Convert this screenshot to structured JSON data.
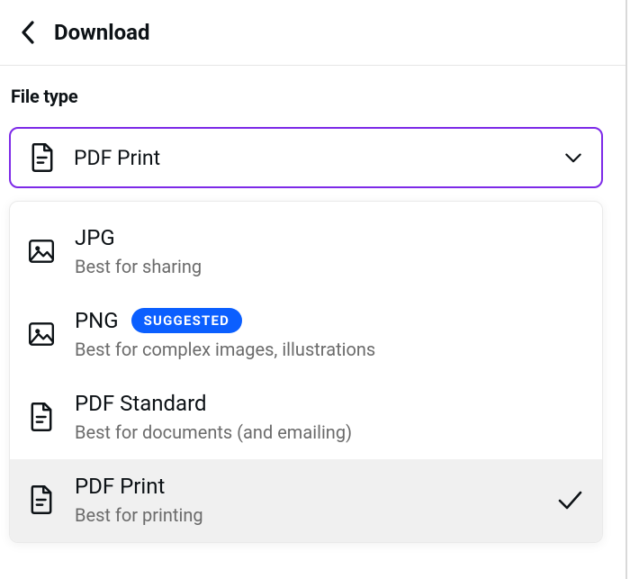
{
  "header": {
    "title": "Download"
  },
  "file_type": {
    "label": "File type",
    "selected_label": "PDF Print",
    "selected_index": 3
  },
  "badge": {
    "text": "SUGGESTED"
  },
  "options": [
    {
      "icon": "image-icon",
      "title": "JPG",
      "desc": "Best for sharing",
      "suggested": false,
      "selected": false
    },
    {
      "icon": "image-icon",
      "title": "PNG",
      "desc": "Best for complex images, illustrations",
      "suggested": true,
      "selected": false
    },
    {
      "icon": "document-icon",
      "title": "PDF Standard",
      "desc": "Best for documents (and emailing)",
      "suggested": false,
      "selected": false
    },
    {
      "icon": "document-icon",
      "title": "PDF Print",
      "desc": "Best for printing",
      "suggested": false,
      "selected": true
    }
  ],
  "colors": {
    "accent": "#7d2ae8",
    "badge_bg": "#0b5fff"
  }
}
